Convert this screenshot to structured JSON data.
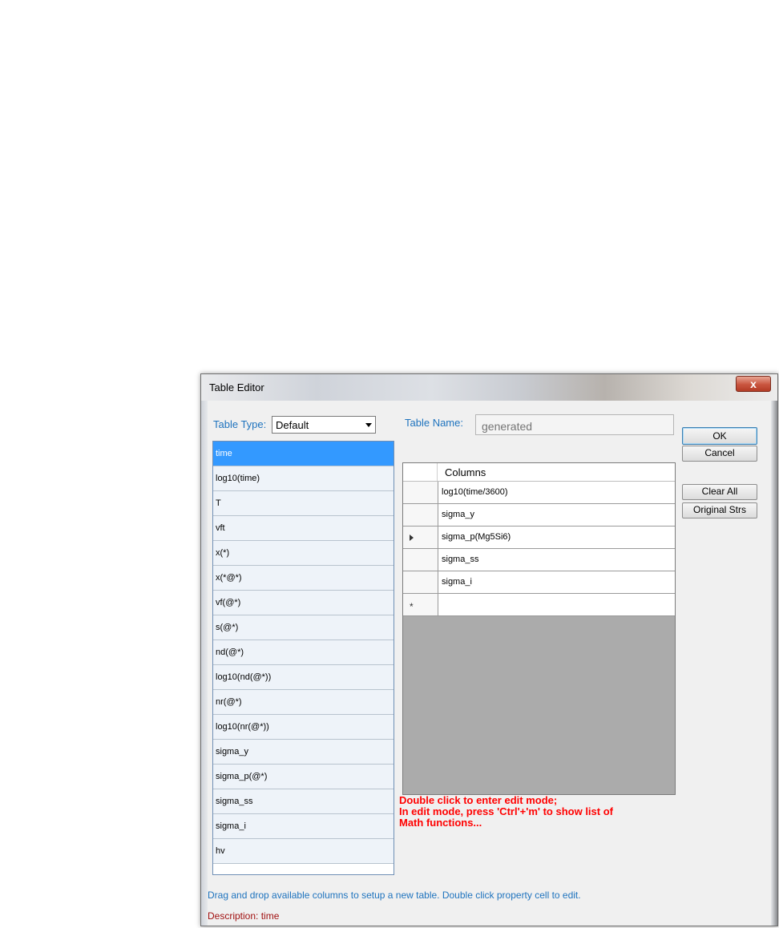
{
  "window": {
    "title": "Table Editor",
    "close_label": "x"
  },
  "table_type": {
    "label": "Table Type:",
    "selected": "Default"
  },
  "table_name": {
    "label": "Table Name:",
    "placeholder": "generated"
  },
  "available_columns": [
    "time",
    "log10(time)",
    "T",
    "vft",
    "x(*)",
    "x(*@*)",
    "vf(@*)",
    "s(@*)",
    "nd(@*)",
    "log10(nd(@*))",
    "nr(@*)",
    "log10(nr(@*))",
    "sigma_y",
    "sigma_p(@*)",
    "sigma_ss",
    "sigma_i",
    "hv"
  ],
  "selected_index": 0,
  "grid": {
    "header": "Columns",
    "rows": [
      "log10(time/3600)",
      "sigma_y",
      "sigma_p(Mg5Si6)",
      "sigma_ss",
      "sigma_i"
    ],
    "current_row_index": 2,
    "new_row_marker": "*"
  },
  "buttons": {
    "ok": "OK",
    "cancel": "Cancel",
    "clear_all": "Clear All",
    "original_strs": "Original Strs"
  },
  "hint": {
    "line1": "Double click to enter edit mode;",
    "line2": "In edit mode, press 'Ctrl'+'m' to show list of",
    "line3": "Math functions..."
  },
  "footer": {
    "instructions": "Drag and drop available columns to setup a new table. Double click property cell to edit.",
    "description": "Description: time"
  },
  "colors": {
    "selection": "#3399ff",
    "label_blue": "#1e73be",
    "hint_red": "#ff0000",
    "description_red": "#a01010"
  }
}
